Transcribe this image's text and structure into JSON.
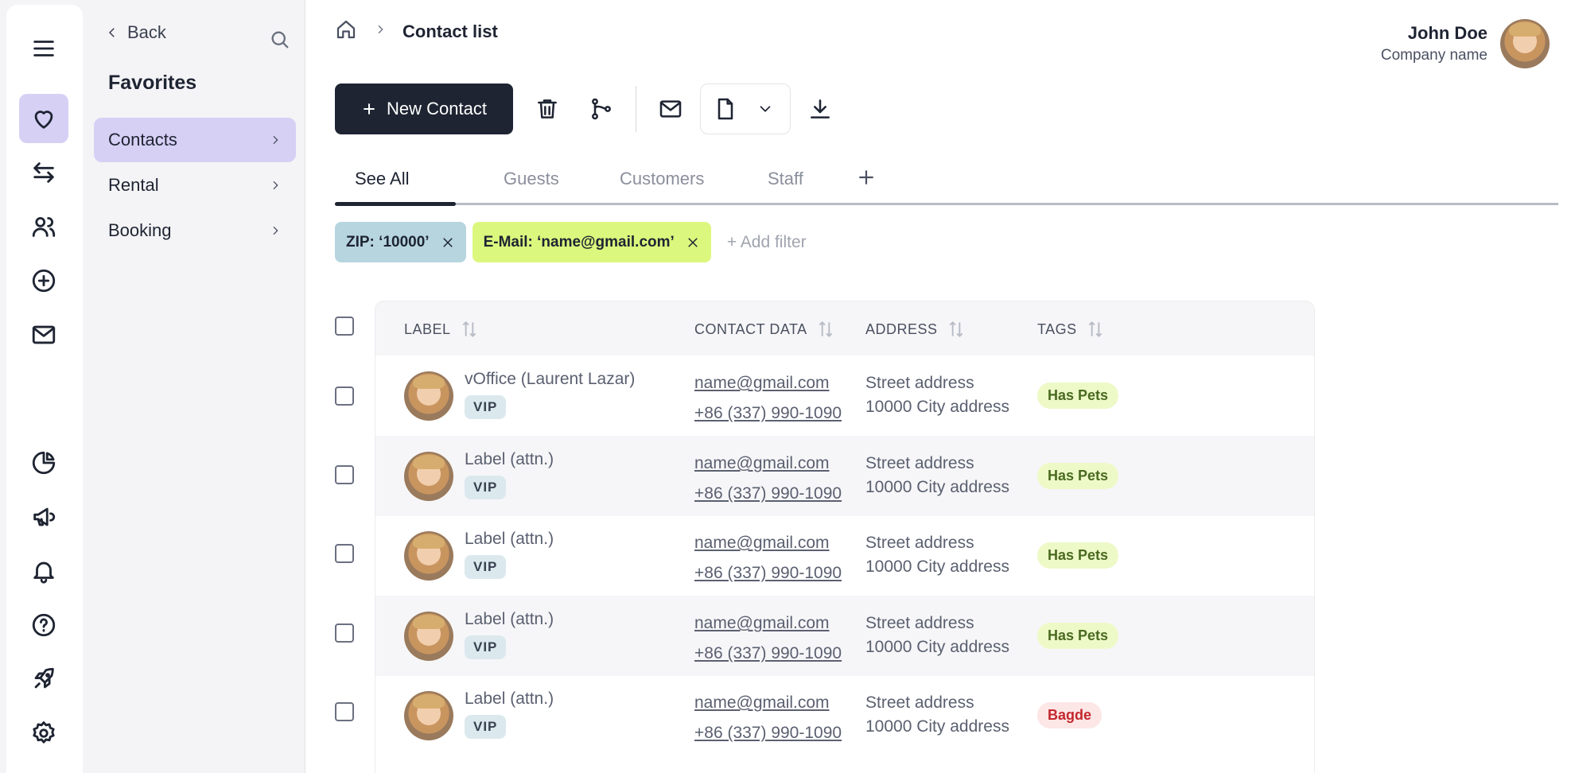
{
  "rail": {
    "items": [
      {
        "icon": "menu-icon"
      },
      {
        "icon": "heart-icon",
        "active": true
      },
      {
        "icon": "transfer-icon"
      },
      {
        "icon": "users-icon"
      },
      {
        "icon": "plus-circle-icon"
      },
      {
        "icon": "mail-icon"
      },
      {
        "icon": "pie-chart-icon"
      },
      {
        "icon": "megaphone-icon"
      },
      {
        "icon": "bell-icon"
      },
      {
        "icon": "help-icon"
      },
      {
        "icon": "rocket-icon"
      },
      {
        "icon": "settings-icon"
      }
    ]
  },
  "panel": {
    "back_label": "Back",
    "title": "Favorites",
    "items": [
      {
        "label": "Contacts",
        "active": true
      },
      {
        "label": "Rental"
      },
      {
        "label": "Booking"
      }
    ]
  },
  "header": {
    "breadcrumb_current": "Contact list",
    "user_name": "John Doe",
    "company_name": "Company name"
  },
  "toolbar": {
    "new_contact_label": "New Contact"
  },
  "tabs": [
    {
      "label": "See All",
      "active": true
    },
    {
      "label": "Guests"
    },
    {
      "label": "Customers"
    },
    {
      "label": "Staff"
    }
  ],
  "filters": {
    "chips": [
      {
        "label": "ZIP: ‘10000’",
        "color": "#b7d5df"
      },
      {
        "label": "E-Mail: ‘name@gmail.com’",
        "color": "#dcf77d"
      }
    ],
    "add_label": "+ Add filter"
  },
  "table": {
    "columns": [
      "LABEL",
      "CONTACT DATA",
      "ADDRESS",
      "TAGS"
    ],
    "rows": [
      {
        "label": "vOffice (Laurent Lazar)",
        "badge": "VIP",
        "email": "name@gmail.com",
        "phone": "+86 (337) 990-1090",
        "street": "Street address",
        "city": "10000 City address",
        "tag": "Has Pets",
        "tag_style": "green"
      },
      {
        "label": "Label (attn.)",
        "badge": "VIP",
        "email": "name@gmail.com",
        "phone": "+86 (337) 990-1090",
        "street": "Street address",
        "city": "10000 City address",
        "tag": "Has Pets",
        "tag_style": "green"
      },
      {
        "label": "Label (attn.)",
        "badge": "VIP",
        "email": "name@gmail.com",
        "phone": "+86 (337) 990-1090",
        "street": "Street address",
        "city": "10000 City address",
        "tag": "Has Pets",
        "tag_style": "green"
      },
      {
        "label": "Label (attn.)",
        "badge": "VIP",
        "email": "name@gmail.com",
        "phone": "+86 (337) 990-1090",
        "street": "Street address",
        "city": "10000 City address",
        "tag": "Has Pets",
        "tag_style": "green"
      },
      {
        "label": "Label (attn.)",
        "badge": "VIP",
        "email": "name@gmail.com",
        "phone": "+86 (337) 990-1090",
        "street": "Street address",
        "city": "10000 City address",
        "tag": "Bagde",
        "tag_style": "red"
      }
    ]
  }
}
